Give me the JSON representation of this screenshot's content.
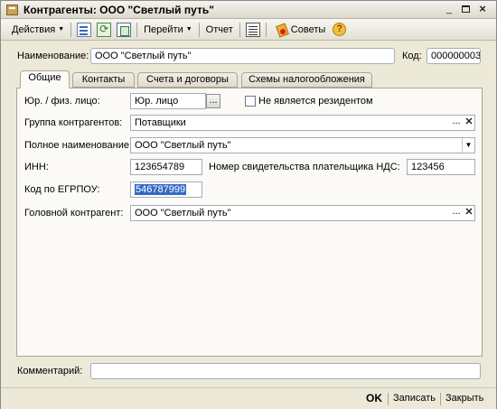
{
  "window": {
    "title": "Контрагенты: ООО \"Светлый путь\""
  },
  "toolbar": {
    "actions_label": "Действия",
    "goto_label": "Перейти",
    "report_label": "Отчет",
    "tips_label": "Советы",
    "help_label": "?"
  },
  "header": {
    "name_label": "Наименование:",
    "name_value": "ООО \"Светлый путь\"",
    "code_label": "Код:",
    "code_value": "000000003"
  },
  "tabs": [
    {
      "label": "Общие"
    },
    {
      "label": "Контакты"
    },
    {
      "label": "Счета и договоры"
    },
    {
      "label": "Схемы налогообложения"
    }
  ],
  "general": {
    "legal_type_label": "Юр. / физ. лицо:",
    "legal_type_value": "Юр. лицо",
    "non_resident_label": "Не является резидентом",
    "group_label": "Группа контрагентов:",
    "group_value": "Потавщики",
    "full_name_label": "Полное наименование:",
    "full_name_value": "ООО \"Светлый путь\"",
    "inn_label": "ИНН:",
    "inn_value": "123654789",
    "vat_cert_label": "Номер свидетельства плательщика НДС:",
    "vat_cert_value": "123456",
    "edrpou_label": "Код по ЕГРПОУ:",
    "edrpou_value": "546787999",
    "head_label": "Головной контрагент:",
    "head_value": "ООО \"Светлый путь\""
  },
  "footer": {
    "comment_label": "Комментарий:",
    "comment_value": "",
    "ok_label": "OK",
    "save_label": "Записать",
    "close_label": "Закрыть"
  },
  "colors": {
    "window_bg": "#ece9d8",
    "selection": "#316ac5"
  }
}
